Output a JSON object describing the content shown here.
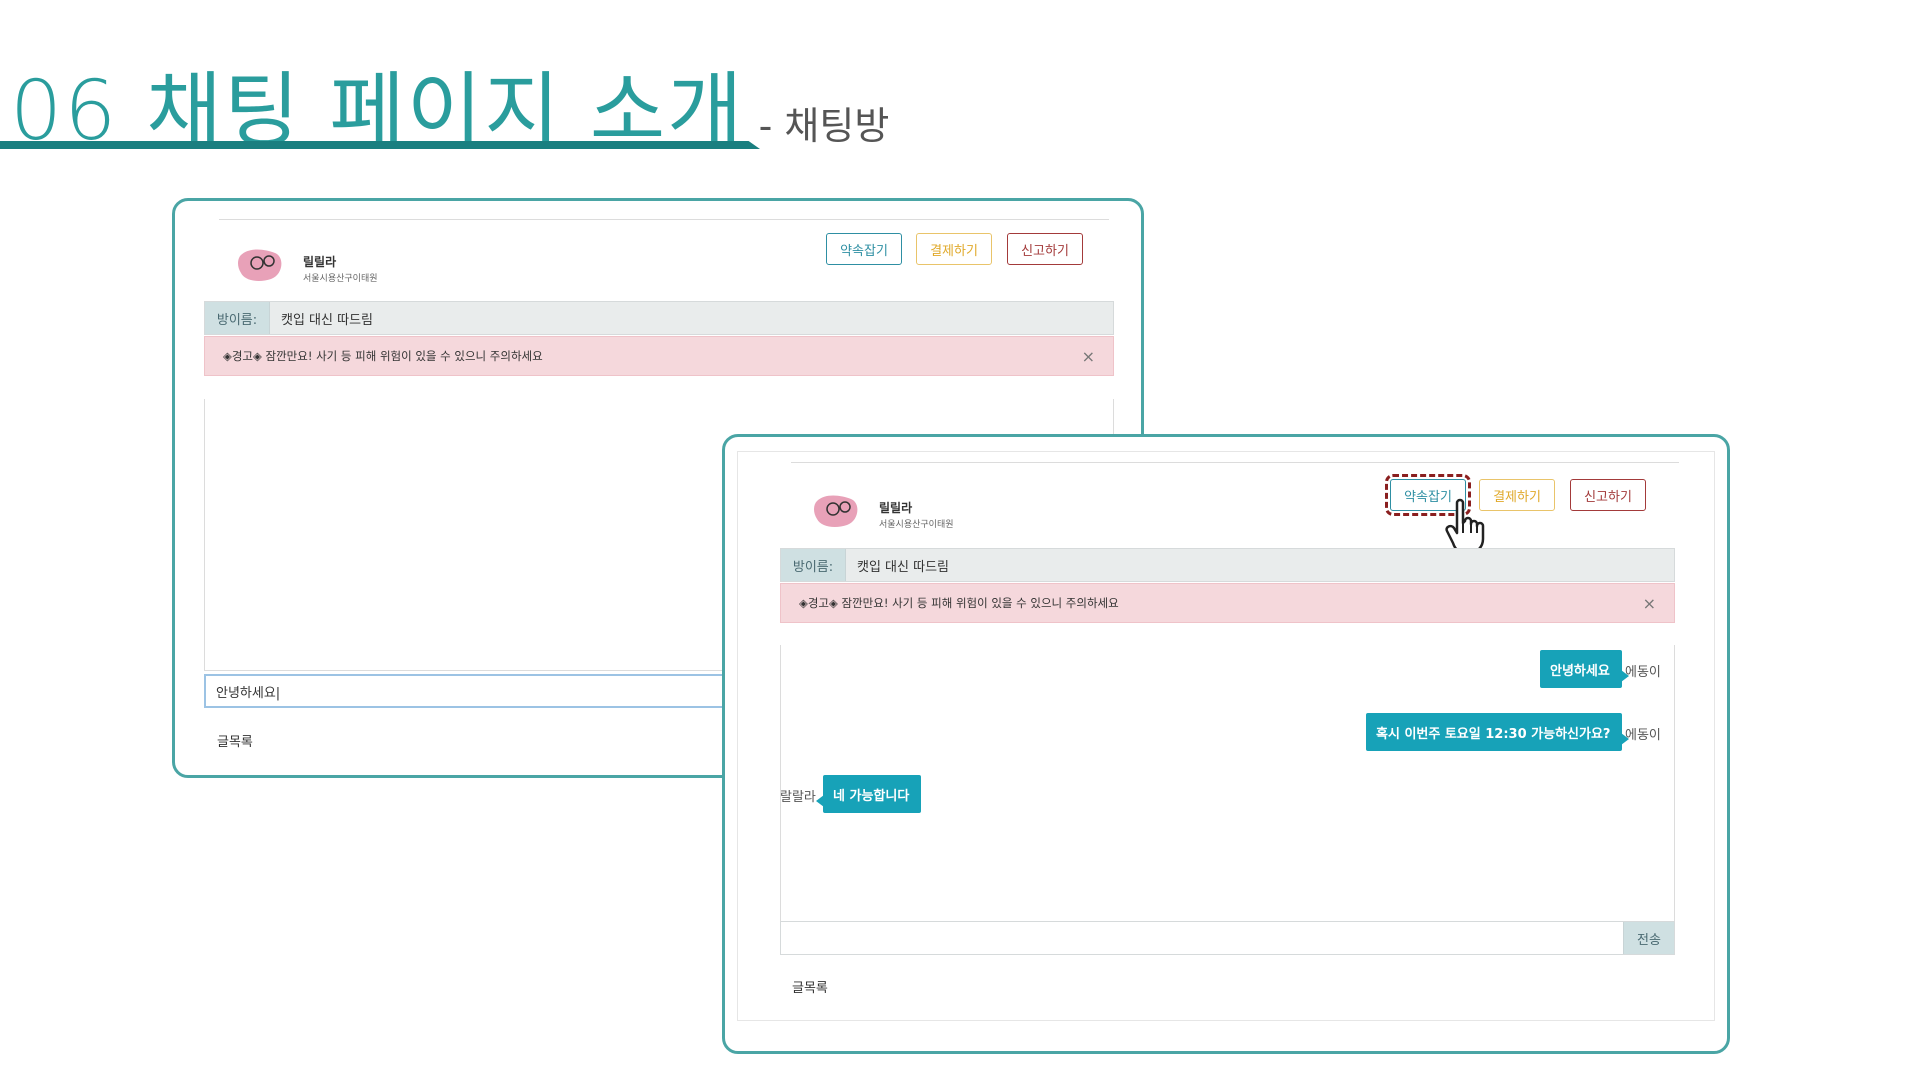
{
  "header": {
    "title": "06 채팅 페이지 소개",
    "subtitle": "- 채팅방"
  },
  "colors": {
    "accent": "#2a9d9d",
    "rule": "#1a7f80",
    "bubble": "#17a2b8",
    "warning_bg": "#f5d8dc",
    "highlight": "#8a1f1f"
  },
  "screen_back": {
    "user": {
      "name": "릴릴라",
      "address": "서울시용산구이태원"
    },
    "buttons": {
      "appointment": "약속잡기",
      "payment": "결제하기",
      "report": "신고하기"
    },
    "room": {
      "label": "방이름:",
      "name": "캣입 대신 따드림"
    },
    "warning": {
      "text": "◈경고◈ 잠깐만요! 사기 등 피해 위험이 있을 수 있으니 주의하세요",
      "close": "×"
    },
    "message_input": {
      "value": "안녕하세요|"
    },
    "board_link": "글목록"
  },
  "screen_front": {
    "user": {
      "name": "릴릴라",
      "address": "서울시용산구이태원"
    },
    "buttons": {
      "appointment": "약속잡기",
      "payment": "결제하기",
      "report": "신고하기"
    },
    "room": {
      "label": "방이름:",
      "name": "캣입 대신 따드림"
    },
    "warning": {
      "text": "◈경고◈ 잠깐만요! 사기 등 피해 위험이 있을 수 있으니 주의하세요",
      "close": "×"
    },
    "messages": [
      {
        "text": "안녕하세요",
        "sender": "에동이",
        "side": "right"
      },
      {
        "text": "혹시 이번주 토요일 12:30 가능하신가요?",
        "sender": "에동이",
        "side": "right"
      },
      {
        "text": "네 가능합니다",
        "sender": "랄랄라",
        "side": "left"
      }
    ],
    "send_button": "전송",
    "board_link": "글목록",
    "cursor_icon": "pointing-hand-icon"
  }
}
